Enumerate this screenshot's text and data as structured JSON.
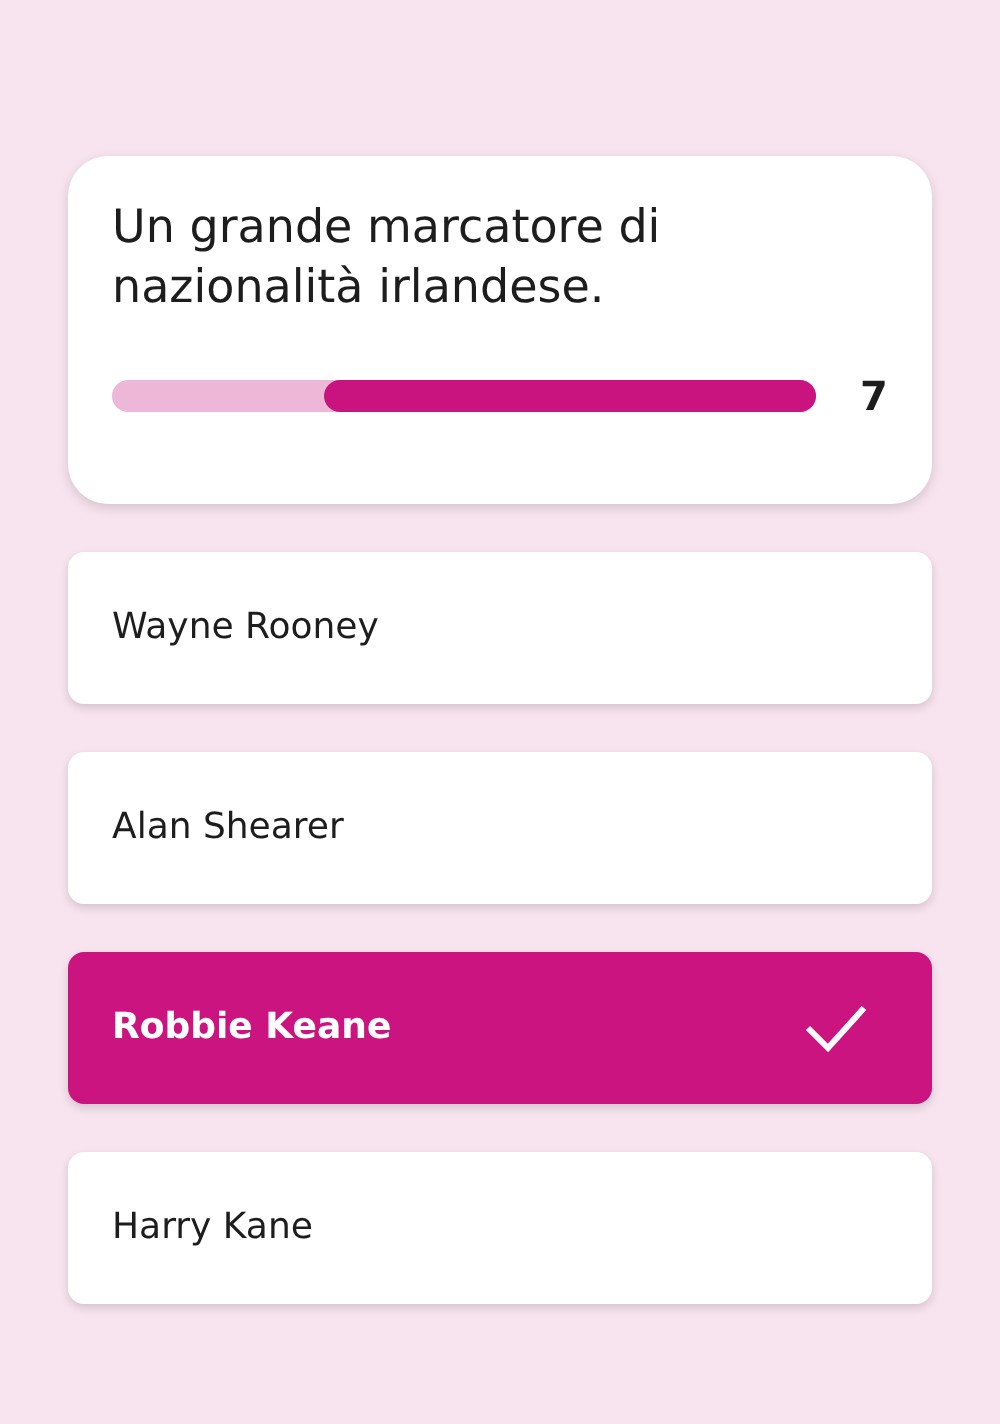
{
  "question": {
    "text": "Un grande marcatore di nazionalità irlandese.",
    "timer": {
      "level": 0.7,
      "value": "7"
    }
  },
  "answers": [
    {
      "label": "Wayne Rooney",
      "selected": false
    },
    {
      "label": "Alan Shearer",
      "selected": false
    },
    {
      "label": "Robbie Keane",
      "selected": true
    },
    {
      "label": "Harry Kane",
      "selected": false
    }
  ]
}
